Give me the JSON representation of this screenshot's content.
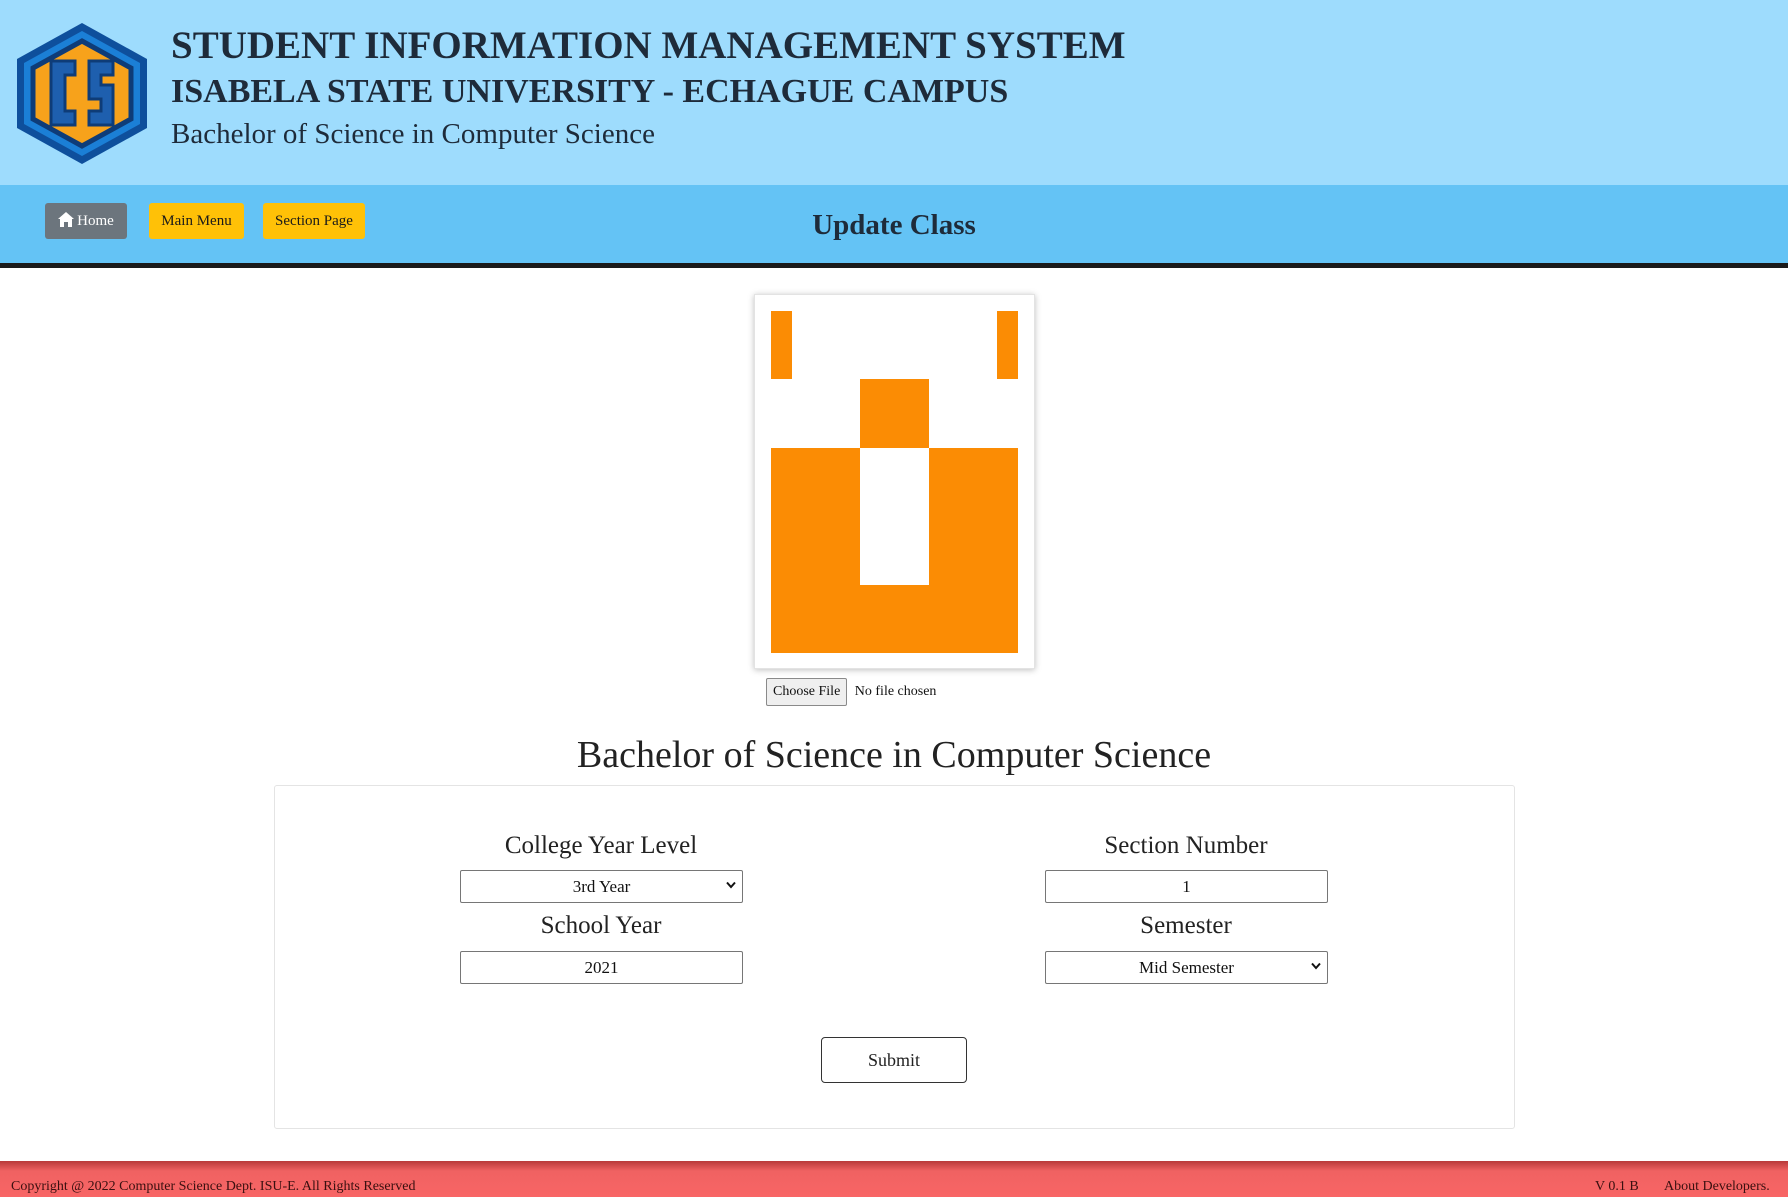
{
  "header": {
    "logo_letters": "CS",
    "title": "STUDENT INFORMATION MANAGEMENT SYSTEM",
    "university": "ISABELA STATE UNIVERSITY - ECHAGUE CAMPUS",
    "program": "Bachelor of Science in Computer Science"
  },
  "navbar": {
    "home_label": "Home",
    "main_menu_label": "Main Menu",
    "section_page_label": "Section Page",
    "page_title": "Update Class"
  },
  "image_upload": {
    "choose_file_label": "Choose File",
    "file_status": "No file chosen"
  },
  "form": {
    "program_title": "Bachelor of Science in Computer Science",
    "year_level": {
      "label": "College Year Level",
      "value": "3rd Year"
    },
    "section_number": {
      "label": "Section Number",
      "value": "1"
    },
    "school_year": {
      "label": "School Year",
      "value": "2021"
    },
    "semester": {
      "label": "Semester",
      "value": "Mid Semester"
    },
    "submit_label": "Submit"
  },
  "footer": {
    "copyright": "Copyright @ 2022 Computer Science Dept. ISU-E. All Rights Reserved",
    "version": "V 0.1 B",
    "about_label": "About Developers."
  },
  "colors": {
    "banner_bg": "#9edcfd",
    "navbar_bg": "#64c3f5",
    "home_button": "#6c757d",
    "yellow_buttons": "#ffc107",
    "placeholder_orange": "#fb8c04",
    "footer_bg": "#f86565",
    "logo_blue": "#1565c0",
    "logo_orange": "#f7a21b"
  }
}
